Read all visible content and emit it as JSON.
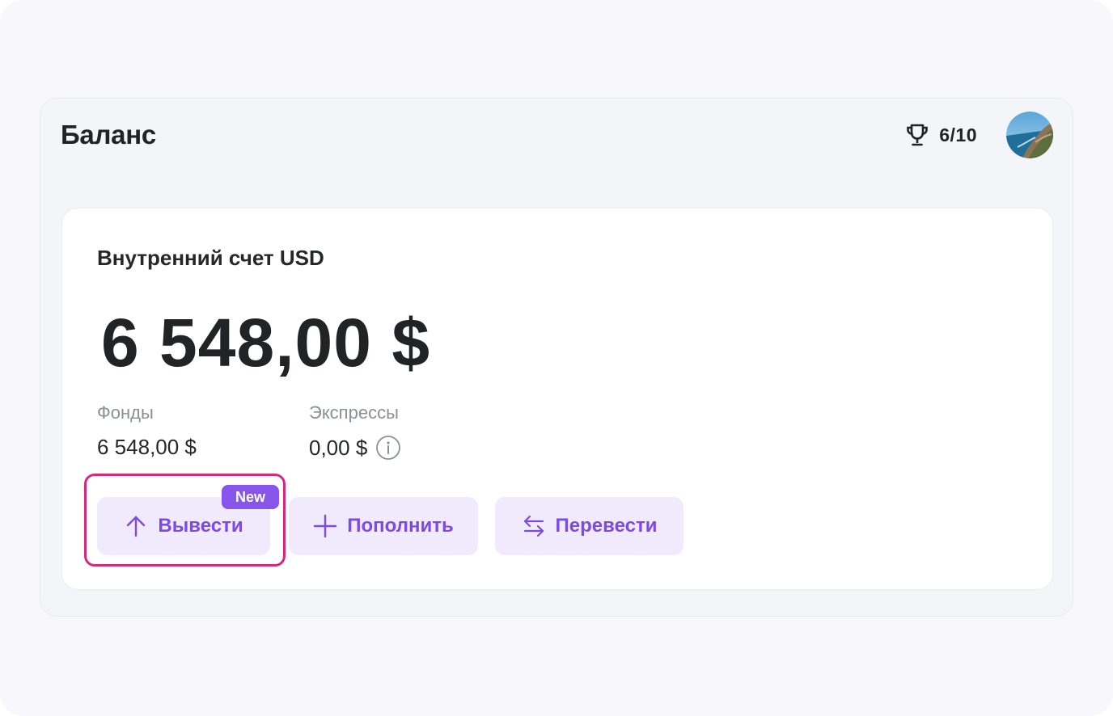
{
  "panel": {
    "title": "Баланс",
    "achievements": {
      "icon": "trophy-icon",
      "count": "6/10"
    },
    "avatar": {
      "icon": "avatar-photo"
    }
  },
  "account": {
    "name": "Внутренний счет USD",
    "total": "6 548,00 $",
    "funds": {
      "label": "Фонды",
      "value": "6 548,00 $"
    },
    "expresses": {
      "label": "Экспрессы",
      "value": "0,00 $",
      "icon": "info-icon"
    }
  },
  "actions": {
    "withdraw": {
      "label": "Вывести",
      "icon": "arrow-up-icon",
      "badge": "New"
    },
    "deposit": {
      "label": "Пополнить",
      "icon": "plus-icon"
    },
    "transfer": {
      "label": "Перевести",
      "icon": "transfer-arrows-icon"
    }
  },
  "colors": {
    "accent": "#7d4be0",
    "button_bg": "#f1eafd",
    "badge_bg": "#8855ea",
    "highlight": "#d6287d"
  }
}
